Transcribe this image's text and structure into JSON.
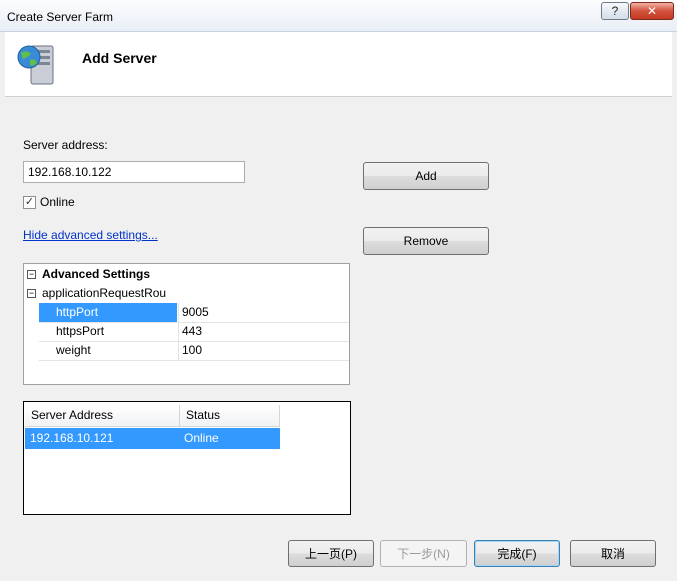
{
  "window": {
    "title": "Create Server Farm",
    "help_label": "?",
    "close_label": "✕"
  },
  "header": {
    "title": "Add Server",
    "icon": "server-globe-icon"
  },
  "form": {
    "server_address_label": "Server address:",
    "server_address_value": "192.168.10.122",
    "online_label": "Online",
    "online_checked": true,
    "advanced_link": "Hide advanced settings...",
    "add_button": "Add",
    "remove_button": "Remove"
  },
  "advanced": {
    "section_title": "Advanced Settings",
    "group_name": "applicationRequestRou",
    "properties": [
      {
        "name": "httpPort",
        "value": "9005",
        "selected": true
      },
      {
        "name": "httpsPort",
        "value": "443",
        "selected": false
      },
      {
        "name": "weight",
        "value": "100",
        "selected": false
      }
    ]
  },
  "server_list": {
    "columns": [
      "Server Address",
      "Status"
    ],
    "rows": [
      {
        "address": "192.168.10.121",
        "status": "Online",
        "selected": true
      }
    ]
  },
  "footer": {
    "prev_button": "上一页(P)",
    "next_button": "下一步(N)",
    "finish_button": "完成(F)",
    "cancel_button": "取消"
  },
  "colors": {
    "selection": "#3399ff",
    "link": "#0033cc"
  }
}
